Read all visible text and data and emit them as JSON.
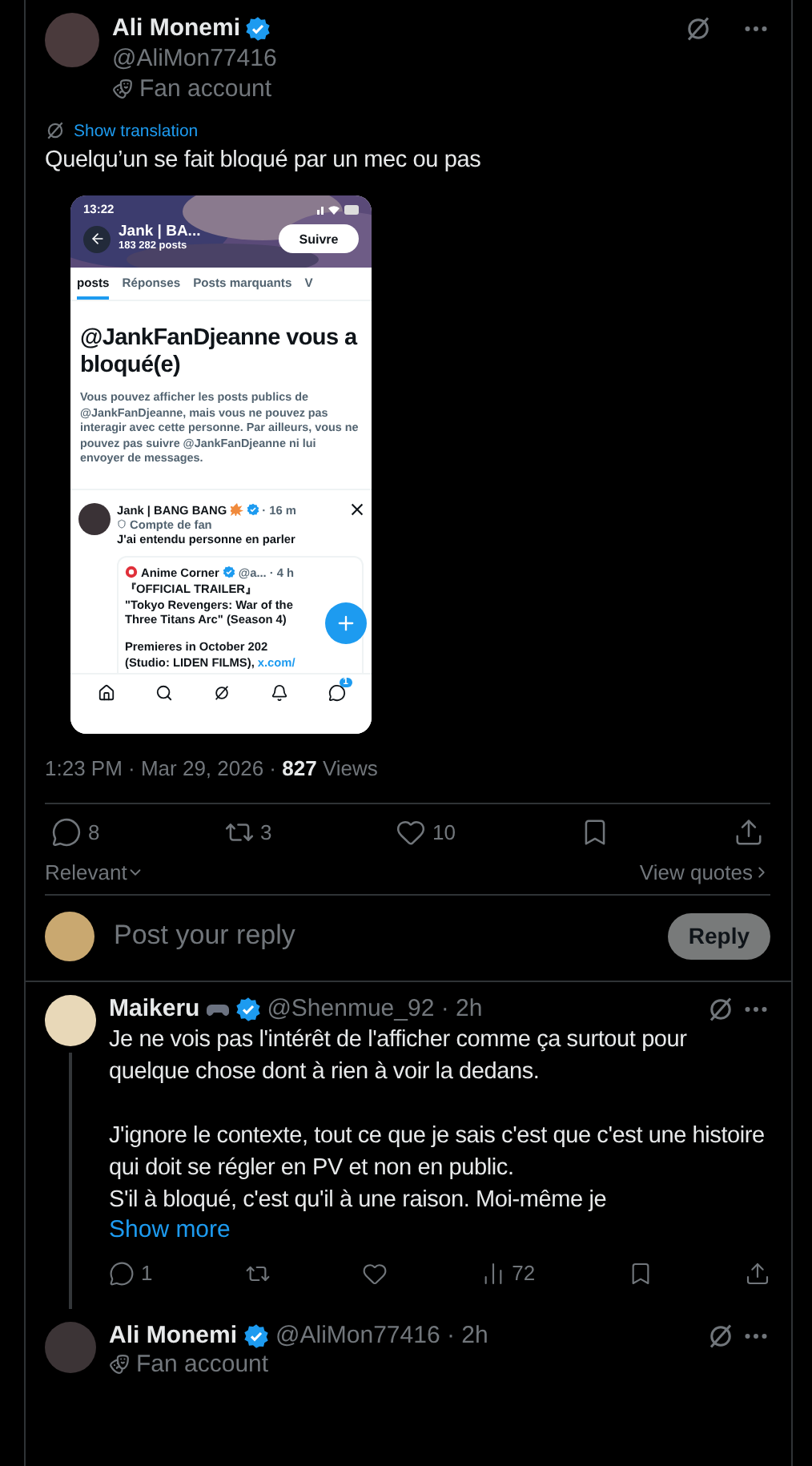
{
  "post": {
    "author": {
      "name": "Ali Monemi",
      "verified": true,
      "handle": "@AliMon77416",
      "badge": "Fan account"
    },
    "translate": "Show translation",
    "text": "Quelqu’un se fait bloqué par un mec ou pas",
    "screenshot": {
      "status_time": "13:22",
      "profile_name": "Jank | BA...",
      "profile_posts": "183 282 posts",
      "follow": "Suivre",
      "tabs": [
        {
          "label": "posts",
          "selected": true
        },
        {
          "label": "Réponses",
          "selected": false
        },
        {
          "label": "Posts marquants",
          "selected": false
        },
        {
          "label": "V",
          "selected": false
        }
      ],
      "blocked_title": "@JankFanDjeanne vous a bloqué(e)",
      "blocked_text": "Vous pouvez afficher les posts publics de @JankFanDjeanne, mais vous ne pouvez pas interagir avec cette personne. Par ailleurs, vous ne pouvez pas suivre @JankFanDjeanne ni lui envoyer de messages.",
      "tweet": {
        "name": "Jank | BANG BANG",
        "time": "· 16 m",
        "badge": "Compte de fan",
        "text": "J'ai entendu personne en parler",
        "quote": {
          "name": "Anime Corner",
          "handle": "@a...",
          "time": "· 4 h",
          "lines": [
            "『OFFICIAL TRAILER』",
            "\"Tokyo Revengers: War of the Three Titans Arc\" (Season 4)"
          ],
          "tail": "Premieres in October 202",
          "tail2": "(Studio: LIDEN FILMS),",
          "link": "x.com/"
        }
      },
      "nav_badge": "1"
    },
    "meta": "1:23 PM · Mar 29, 2026 · **827** Views",
    "actions": [
      {
        "kind": "reply",
        "count": "8"
      },
      {
        "kind": "repost",
        "count": "3"
      },
      {
        "kind": "like",
        "count": "10"
      },
      {
        "kind": "bookmark"
      },
      {
        "kind": "share"
      }
    ],
    "sort": "Relevant",
    "view_quotes": "View quotes",
    "composer": {
      "placeholder": "Post your reply",
      "button": "Reply"
    }
  },
  "replies": [
    {
      "name": "Maikeru",
      "verified": true,
      "handle": "@Shenmue_92 · 2h",
      "thread": true,
      "paragraphs": [
        "Je ne vois pas l'intérêt de l'afficher comme ça surtout pour quelque chose dont à rien à voir la dedans.",
        "J'ignore le contexte, tout ce que je sais c'est que c'est une histoire qui doit se régler en PV et non en public.\nS'il à bloqué, c'est qu'il à une raison. Moi-même je"
      ],
      "show_more": "Show more",
      "actions": [
        {
          "kind": "reply",
          "count": "1"
        },
        {
          "kind": "repost"
        },
        {
          "kind": "like"
        },
        {
          "kind": "views",
          "count": "72"
        },
        {
          "kind": "bookmark"
        },
        {
          "kind": "share"
        }
      ]
    },
    {
      "name": "Ali Monemi",
      "verified": true,
      "handle": "@AliMon77416 · 2h",
      "thread": false,
      "badge": "Fan account"
    }
  ]
}
